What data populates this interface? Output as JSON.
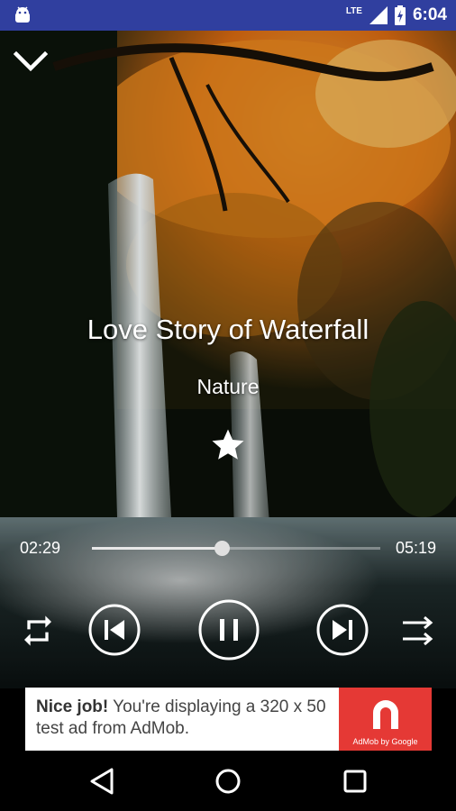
{
  "status_bar": {
    "network": "LTE",
    "time": "6:04"
  },
  "player": {
    "title": "Love Story of Waterfall",
    "artist": "Nature",
    "current_time": "02:29",
    "total_time": "05:19",
    "progress": 0.45,
    "favorite": true,
    "state": "playing"
  },
  "ad": {
    "bold_text": "Nice job!",
    "text": "You're displaying a 320 x 50 test ad from AdMob.",
    "logo_caption": "AdMob by Google"
  },
  "colors": {
    "status_bar": "#303f9f",
    "ad_logo": "#e53935",
    "foliage": "#e8871e"
  },
  "icons": {
    "collapse": "chevron-down-icon",
    "favorite": "star-icon",
    "repeat": "repeat-icon",
    "previous": "skip-previous-icon",
    "play_pause": "pause-icon",
    "next": "skip-next-icon",
    "shuffle": "shuffle-icon"
  }
}
